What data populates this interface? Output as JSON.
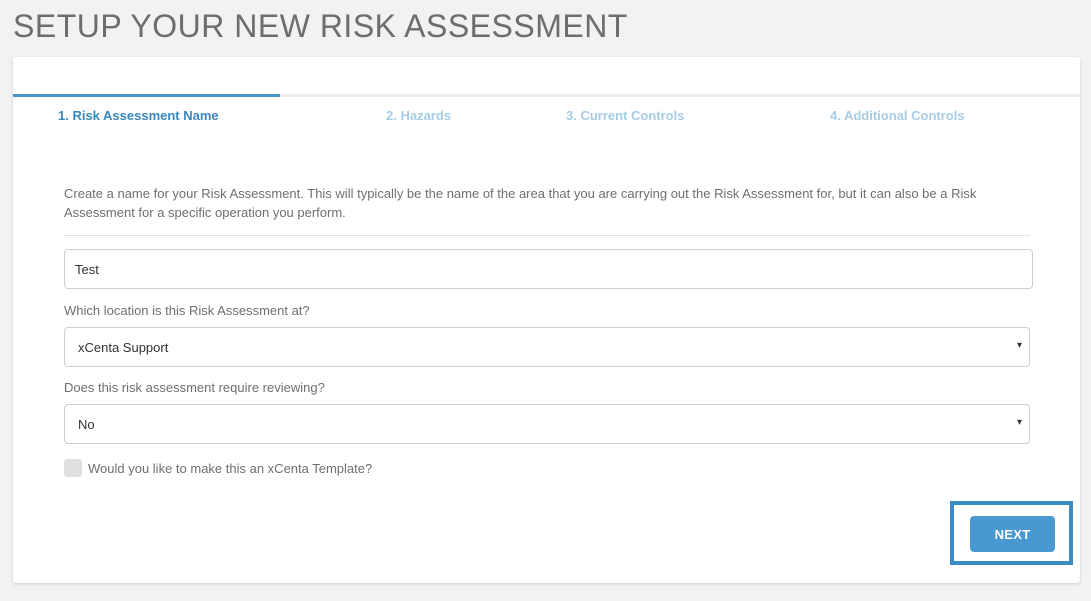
{
  "page": {
    "title": "SETUP YOUR NEW RISK ASSESSMENT"
  },
  "tabs": [
    {
      "label": "1. Risk Assessment Name",
      "active": true
    },
    {
      "label": "2. Hazards",
      "active": false
    },
    {
      "label": "3. Current Controls",
      "active": false
    },
    {
      "label": "4. Additional Controls",
      "active": false
    }
  ],
  "form": {
    "intro": "Create a name for your Risk Assessment. This will typically be the name of the area that you are carrying out the Risk Assessment for, but it can also be a Risk Assessment for a specific operation you perform.",
    "name_value": "Test",
    "location_label": "Which location is this Risk Assessment at?",
    "location_value": "xCenta Support",
    "review_label": "Does this risk assessment require reviewing?",
    "review_value": "No",
    "template_label": "Would you like to make this an xCenta Template?",
    "template_checked": false,
    "caret": "▾"
  },
  "actions": {
    "next_label": "NEXT"
  },
  "colors": {
    "accent": "#4a98d0",
    "tab_active": "#3a87bd",
    "tab_inactive": "#a6cde5",
    "highlight_border": "#3a8cc4"
  }
}
